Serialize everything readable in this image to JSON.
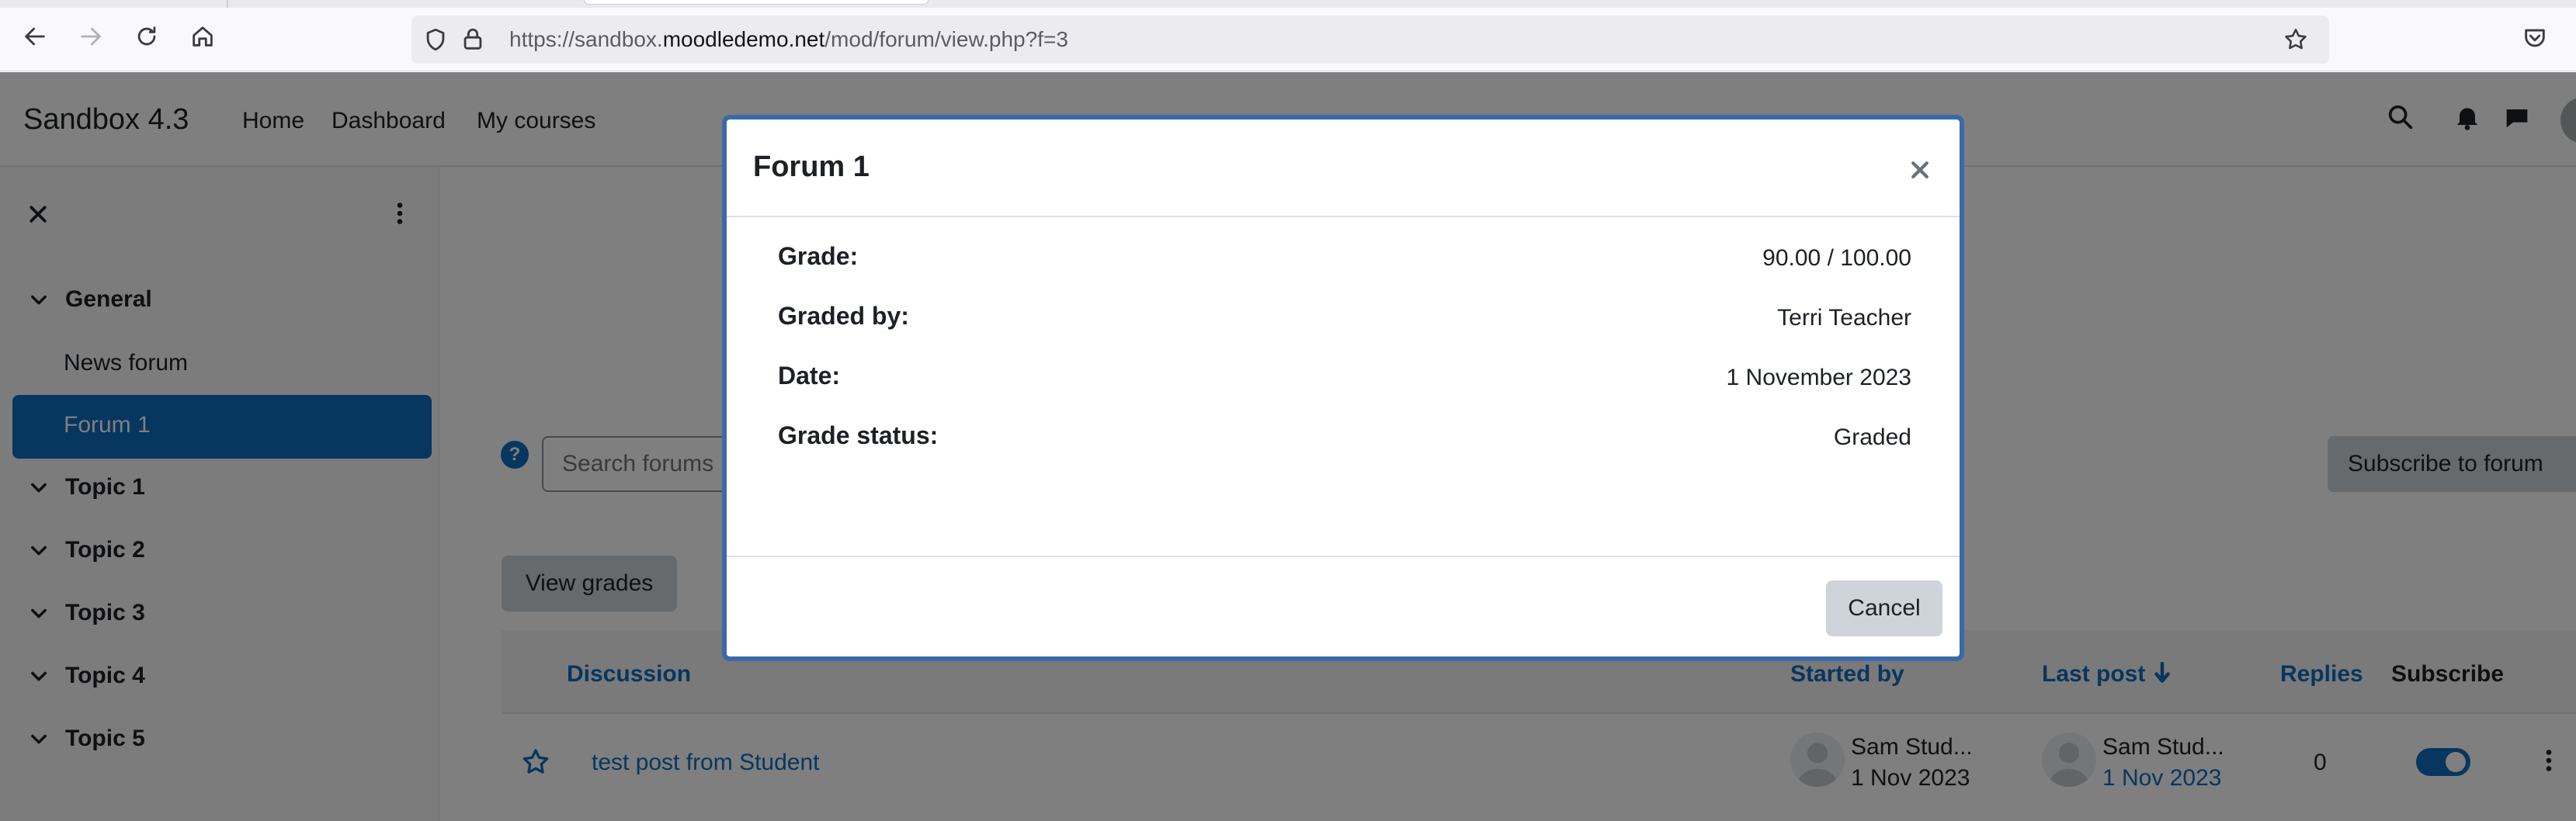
{
  "browser": {
    "url_prefix": "https://sandbox.",
    "url_domain": "moodledemo.net",
    "url_path": "/mod/forum/view.php?f=3"
  },
  "navbar": {
    "brand": "Sandbox 4.3",
    "links": [
      "Home",
      "Dashboard",
      "My courses"
    ]
  },
  "drawer": {
    "sections": [
      {
        "label": "General",
        "items": [
          "News forum",
          "Forum 1"
        ]
      },
      {
        "label": "Topic 1"
      },
      {
        "label": "Topic 2"
      },
      {
        "label": "Topic 3"
      },
      {
        "label": "Topic 4"
      },
      {
        "label": "Topic 5"
      }
    ],
    "active_item": "Forum 1"
  },
  "main": {
    "search_placeholder": "Search forums",
    "subscribe_label": "Subscribe to forum",
    "view_grades_label": "View grades",
    "table": {
      "headers": {
        "discussion": "Discussion",
        "started_by": "Started by",
        "last_post": "Last post",
        "replies": "Replies",
        "subscribe": "Subscribe"
      },
      "rows": [
        {
          "discussion": "test post from Student",
          "started_by_name": "Sam Stud...",
          "started_by_date": "1 Nov 2023",
          "last_post_name": "Sam Stud...",
          "last_post_date": "1 Nov 2023",
          "replies": "0",
          "subscribed": true
        }
      ]
    }
  },
  "modal": {
    "title": "Forum 1",
    "fields": [
      {
        "label": "Grade:",
        "value": "90.00 / 100.00"
      },
      {
        "label": "Graded by:",
        "value": "Terri Teacher"
      },
      {
        "label": "Date:",
        "value": "1 November 2023"
      },
      {
        "label": "Grade status:",
        "value": "Graded"
      }
    ],
    "cancel_label": "Cancel"
  },
  "colors": {
    "primary": "#0f6cbf",
    "modal_border": "#3a6aa8"
  }
}
